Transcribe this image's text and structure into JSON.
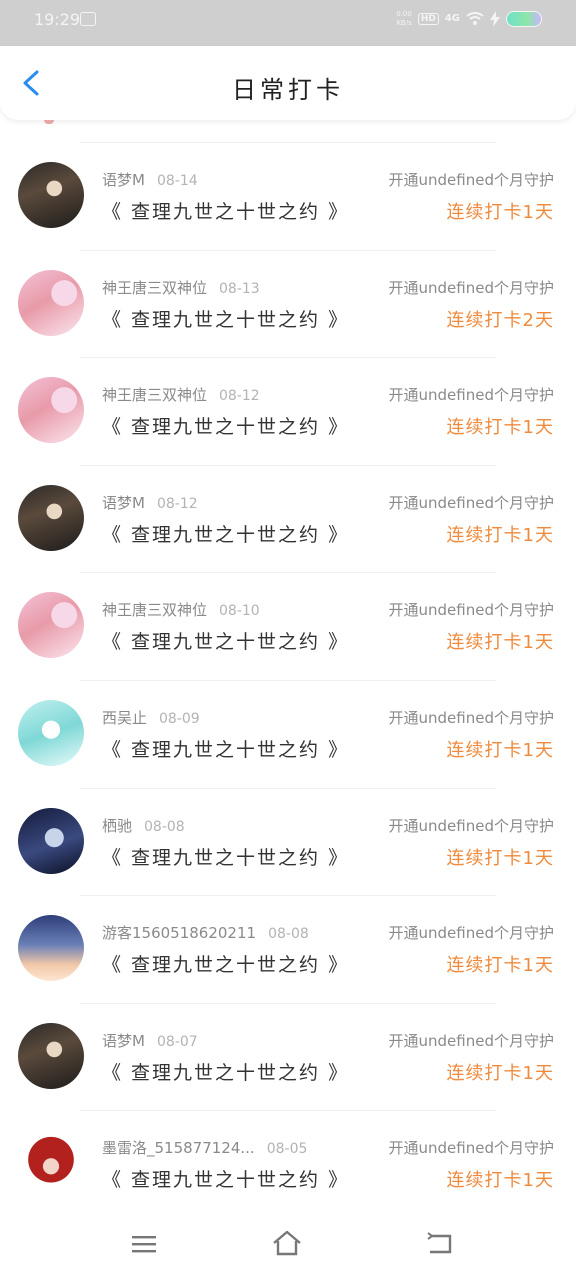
{
  "status_bar": {
    "time": "19:29",
    "net_speed": "0.00",
    "net_speed_unit": "KB/s",
    "hd": "HD",
    "network": "4G"
  },
  "header": {
    "title": "日常打卡"
  },
  "entries": [
    {
      "user": "语梦M",
      "date": "08-14",
      "book": "《 查理九世之十世之约 》",
      "status": "开通undefined个月守护",
      "streak": "连续打卡1天"
    },
    {
      "user": "神王唐三双神位",
      "date": "08-13",
      "book": "《 查理九世之十世之约 》",
      "status": "开通undefined个月守护",
      "streak": "连续打卡2天"
    },
    {
      "user": "神王唐三双神位",
      "date": "08-12",
      "book": "《 查理九世之十世之约 》",
      "status": "开通undefined个月守护",
      "streak": "连续打卡1天"
    },
    {
      "user": "语梦M",
      "date": "08-12",
      "book": "《 查理九世之十世之约 》",
      "status": "开通undefined个月守护",
      "streak": "连续打卡1天"
    },
    {
      "user": "神王唐三双神位",
      "date": "08-10",
      "book": "《 查理九世之十世之约 》",
      "status": "开通undefined个月守护",
      "streak": "连续打卡1天"
    },
    {
      "user": "西吴止",
      "date": "08-09",
      "book": "《 查理九世之十世之约 》",
      "status": "开通undefined个月守护",
      "streak": "连续打卡1天"
    },
    {
      "user": "栖驰",
      "date": "08-08",
      "book": "《 查理九世之十世之约 》",
      "status": "开通undefined个月守护",
      "streak": "连续打卡1天"
    },
    {
      "user": "游客1560518620211",
      "date": "08-08",
      "book": "《 查理九世之十世之约 》",
      "status": "开通undefined个月守护",
      "streak": "连续打卡1天"
    },
    {
      "user": "语梦M",
      "date": "08-07",
      "book": "《 查理九世之十世之约 》",
      "status": "开通undefined个月守护",
      "streak": "连续打卡1天"
    },
    {
      "user": "墨雷洛_515877124...",
      "date": "08-05",
      "book": "《 查理九世之十世之约 》",
      "status": "开通undefined个月守护",
      "streak": "连续打卡1天"
    }
  ],
  "colors": {
    "accent": "#f08a3c",
    "back_arrow": "#2a8df0"
  }
}
